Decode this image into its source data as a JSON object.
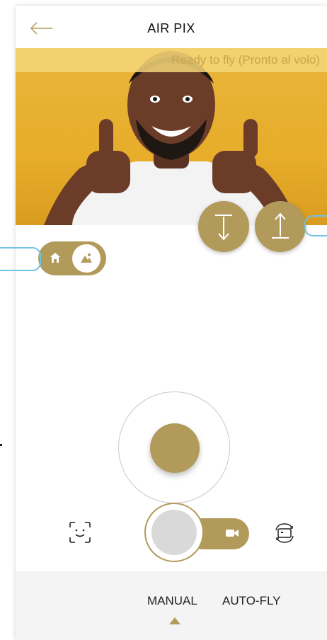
{
  "header": {
    "title": "AIR PIX",
    "back_icon": "back-arrow-icon"
  },
  "camera": {
    "status_banner": "Ready to fly (Pronto al volo)"
  },
  "controls": {
    "descend_icon": "arrow-down-icon",
    "ascend_icon": "arrow-up-icon",
    "view_toggle": {
      "left_icon": "home-icon",
      "right_icon": "landscape-icon",
      "selected": "landscape"
    },
    "face_icon": "face-scan-icon",
    "rotate_icon": "camera-rotate-icon",
    "video_icon": "video-camera-icon"
  },
  "modes": {
    "tabs": [
      {
        "label": "MANUAL",
        "selected": true
      },
      {
        "label": "AUTO-FLY",
        "selected": false
      }
    ]
  },
  "colors": {
    "accent": "#b29a5b",
    "callout": "#6ec3e6",
    "banner": "#f5d678",
    "photo_background": "#e7ad2b"
  }
}
